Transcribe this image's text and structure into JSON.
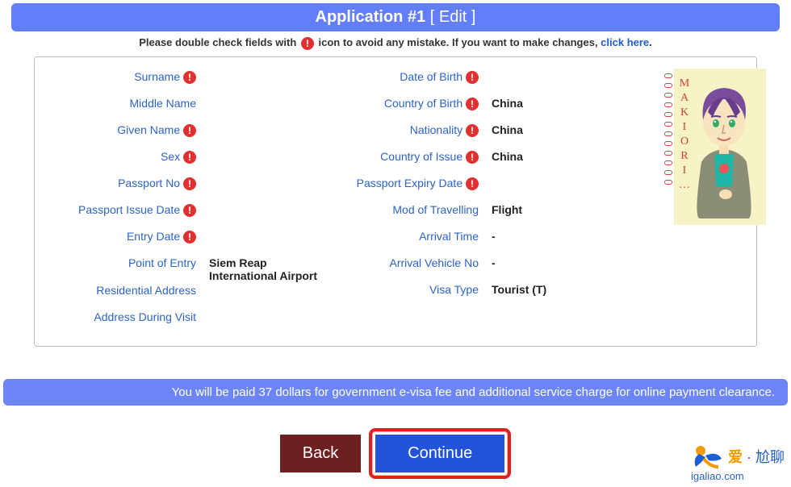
{
  "header": {
    "title": "Application #1",
    "edit_label": "[ Edit ]"
  },
  "warning": {
    "prefix": "Please double check fields with ",
    "suffix": " icon to avoid any mistake. If you want to make changes, ",
    "link": "click here",
    "tail": "."
  },
  "fields_left": [
    {
      "label": "Surname",
      "alert": true,
      "value": ""
    },
    {
      "label": "Middle Name",
      "alert": false,
      "value": ""
    },
    {
      "label": "Given Name",
      "alert": true,
      "value": ""
    },
    {
      "label": "Sex",
      "alert": true,
      "value": ""
    },
    {
      "label": "Passport No",
      "alert": true,
      "value": ""
    },
    {
      "label": "Passport Issue Date",
      "alert": true,
      "value": ""
    },
    {
      "label": "Entry Date",
      "alert": true,
      "value": ""
    },
    {
      "label": "Point of Entry",
      "alert": false,
      "value": "Siem Reap International Airport"
    },
    {
      "label": "Residential Address",
      "alert": false,
      "value": ""
    },
    {
      "label": "Address During Visit",
      "alert": false,
      "value": ""
    }
  ],
  "fields_right": [
    {
      "label": "Date of Birth",
      "alert": true,
      "value": ""
    },
    {
      "label": "Country of Birth",
      "alert": true,
      "value": "China"
    },
    {
      "label": "Nationality",
      "alert": true,
      "value": "China"
    },
    {
      "label": "Country of Issue",
      "alert": true,
      "value": "China"
    },
    {
      "label": "Passport Expiry Date",
      "alert": true,
      "value": ""
    },
    {
      "label": "Mod of Travelling",
      "alert": false,
      "value": "Flight"
    },
    {
      "label": "Arrival Time",
      "alert": false,
      "value": "-"
    },
    {
      "label": "Arrival Vehicle No",
      "alert": false,
      "value": "-"
    },
    {
      "label": "Visa Type",
      "alert": false,
      "value": "Tourist (T)"
    }
  ],
  "photo_caption": "MAKIORI…",
  "fee_notice": "You will be paid 37 dollars for government e-visa fee and additional service charge for online payment clearance.",
  "buttons": {
    "back": "Back",
    "continue": "Continue"
  },
  "watermark": {
    "brand_a": "爱",
    "dot": " · ",
    "brand_b": "尬聊",
    "url": "igaliao.com"
  },
  "alert_glyph": "!"
}
